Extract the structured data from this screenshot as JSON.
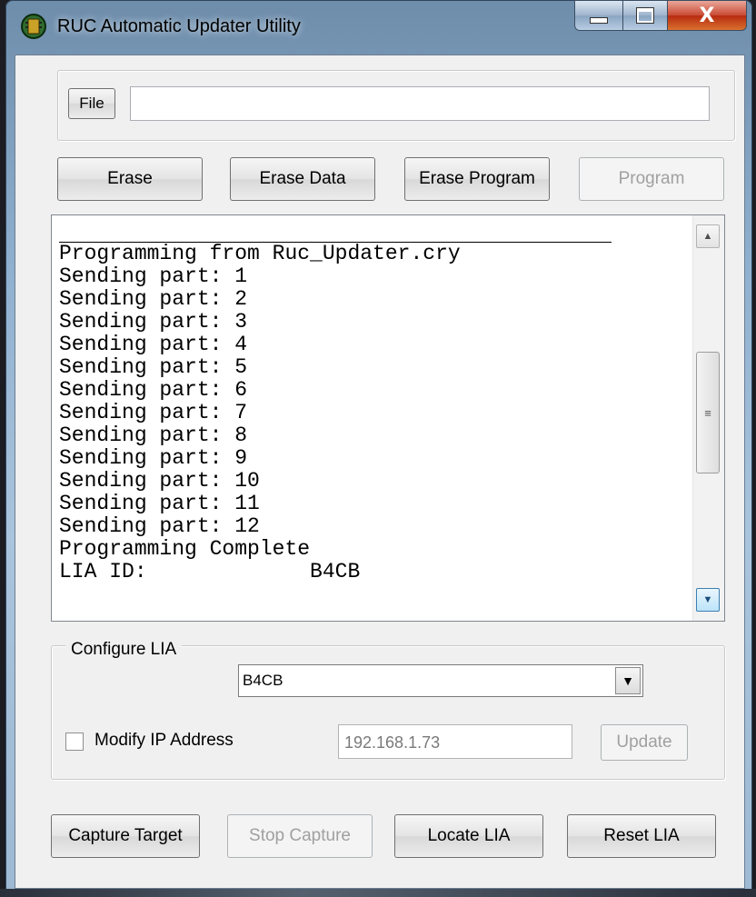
{
  "window": {
    "title": "RUC Automatic Updater Utility",
    "close_label": "X"
  },
  "file": {
    "button_label": "File",
    "path_value": ""
  },
  "actions": {
    "erase": "Erase",
    "erase_data": "Erase Data",
    "erase_program": "Erase Program",
    "program": "Program"
  },
  "log": {
    "lines": [
      "Programming from Ruc_Updater.cry",
      "Sending part: 1",
      "Sending part: 2",
      "Sending part: 3",
      "Sending part: 4",
      "Sending part: 5",
      "Sending part: 6",
      "Sending part: 7",
      "Sending part: 8",
      "Sending part: 9",
      "Sending part: 10",
      "Sending part: 11",
      "Sending part: 12",
      "Programming Complete",
      "LIA ID:             B4CB"
    ]
  },
  "configure": {
    "legend": "Configure LIA",
    "selected_lia": "B4CB",
    "modify_ip_label": "Modify IP Address",
    "modify_ip_checked": false,
    "ip_value": "192.168.1.73",
    "update_label": "Update"
  },
  "bottom": {
    "capture_target": "Capture Target",
    "stop_capture": "Stop Capture",
    "locate_lia": "Locate LIA",
    "reset_lia": "Reset LIA"
  },
  "icons": {
    "app": "app-chip-icon",
    "scroll_up": "scroll-up-arrow-icon",
    "scroll_down": "scroll-down-arrow-icon",
    "thumb_grip": "grip-icon",
    "combo_arrow": "dropdown-arrow-icon"
  },
  "colors": {
    "client_bg": "#f0f0f0",
    "disabled_text": "#a0a0a0"
  }
}
